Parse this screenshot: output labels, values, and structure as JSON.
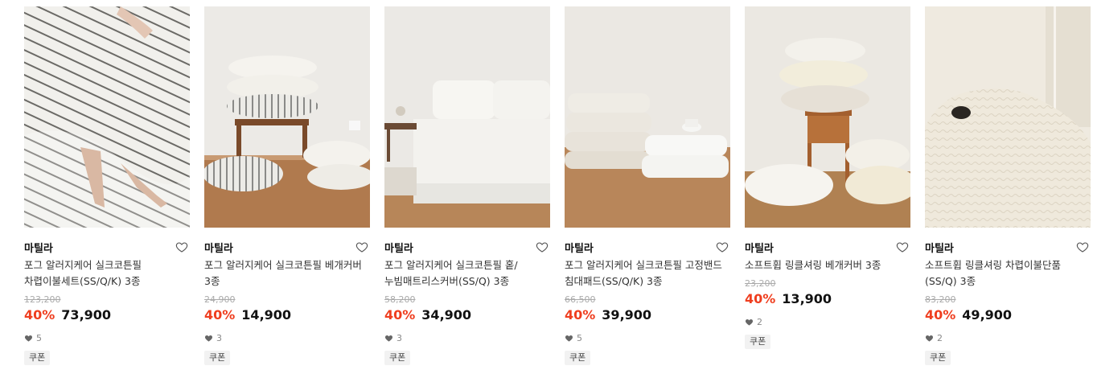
{
  "products": [
    {
      "brand": "마틸라",
      "title_line1": "포그 알러지케어 실크코튼필",
      "title_line2": "차렵이불세트(SS/Q/K) 3종",
      "original_price": "123,200",
      "discount": "40%",
      "price": "73,900",
      "likes": "5",
      "badge": "쿠폰",
      "heart_icon": "heart-outline-icon"
    },
    {
      "brand": "마틸라",
      "title_line1": "포그 알러지케어 실크코튼필 베개커버",
      "title_line2": "3종",
      "original_price": "24,900",
      "discount": "40%",
      "price": "14,900",
      "likes": "3",
      "badge": "쿠폰",
      "heart_icon": "heart-outline-icon"
    },
    {
      "brand": "마틸라",
      "title_line1": "포그 알러지케어 실크코튼필 홑/",
      "title_line2": "누빔매트리스커버(SS/Q) 3종",
      "original_price": "58,200",
      "discount": "40%",
      "price": "34,900",
      "likes": "3",
      "badge": "쿠폰",
      "heart_icon": "heart-outline-icon"
    },
    {
      "brand": "마틸라",
      "title_line1": "포그 알러지케어 실크코튼필 고정밴드",
      "title_line2": "침대패드(SS/Q/K) 3종",
      "original_price": "66,500",
      "discount": "40%",
      "price": "39,900",
      "likes": "5",
      "badge": "쿠폰",
      "heart_icon": "heart-outline-icon"
    },
    {
      "brand": "마틸라",
      "title_line1": "소프트휩 링클셔링 베개커버 3종",
      "title_line2": "",
      "original_price": "23,200",
      "discount": "40%",
      "price": "13,900",
      "likes": "2",
      "badge": "쿠폰",
      "heart_icon": "heart-outline-icon"
    },
    {
      "brand": "마틸라",
      "title_line1": "소프트휩 링클셔링 차렵이불단품",
      "title_line2": "(SS/Q) 3종",
      "original_price": "83,200",
      "discount": "40%",
      "price": "49,900",
      "likes": "2",
      "badge": "쿠폰",
      "heart_icon": "heart-outline-icon"
    }
  ],
  "colors": {
    "discount": "#ef3e1f",
    "price": "#111111",
    "muted": "#aaaaaa",
    "badge_bg": "#f2f2f2"
  }
}
